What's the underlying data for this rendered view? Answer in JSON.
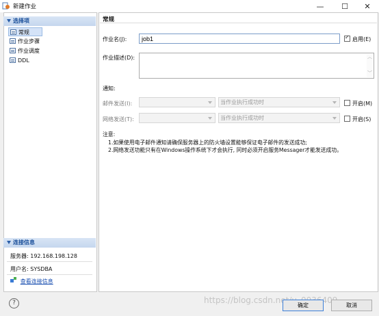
{
  "window": {
    "title": "新建作业",
    "min": "—",
    "max": "☐",
    "close": "✕"
  },
  "sidebar": {
    "options_header": "选择项",
    "items": [
      {
        "label": "常规",
        "selected": true
      },
      {
        "label": "作业步骤"
      },
      {
        "label": "作业调度"
      },
      {
        "label": "DDL"
      }
    ],
    "conn_header": "连接信息",
    "server": "服务器: 192.168.198.128",
    "user": "用户名: SYSDBA",
    "view_conn": "查看连接信息"
  },
  "main": {
    "title": "常规",
    "job_name_label": "作业名(J):",
    "job_name_value": "job1",
    "enable_label": "启用(E)",
    "desc_label": "作业描述(D):",
    "notify_label": "通知:",
    "mail_label": "邮件发送(I):",
    "mail_combo": "",
    "mail_condition": "当作业执行成功时",
    "mail_enable": "开启(M)",
    "net_label": "网络发送(T):",
    "net_combo": "",
    "net_condition": "当作业执行成功时",
    "net_enable": "开启(S)",
    "note_title": "注意:",
    "note1": "1.如果使用电子邮件通知请确保服务器上的防火墙设置能够保证电子邮件的发送成功;",
    "note2": "2.网络发送功能只有在Windows操作系统下才会执行, 同时必须开启服务Messager才能发送成功。"
  },
  "footer": {
    "help": "?",
    "ok": "确定",
    "cancel": "取消",
    "watermark": "https://blog.csdn.net/u_0036409"
  }
}
